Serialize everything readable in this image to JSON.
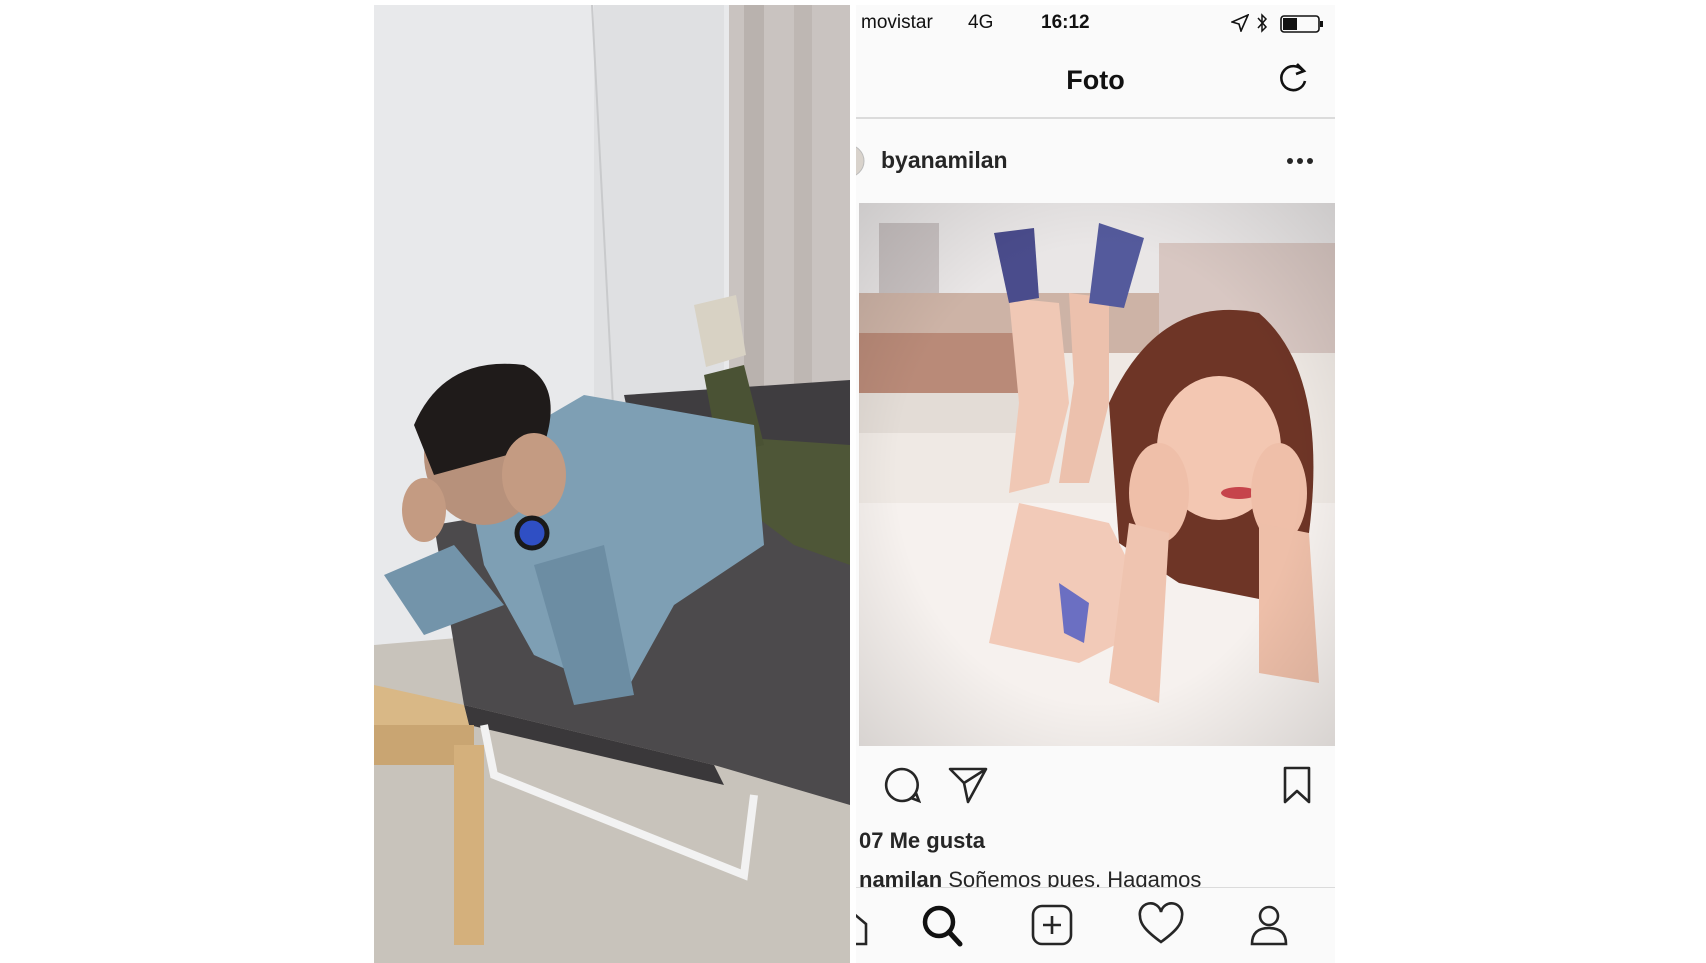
{
  "status_bar": {
    "carrier": "movistar",
    "network": "4G",
    "time": "16:12",
    "location_icon": "location-arrow-icon",
    "bluetooth_icon": "bluetooth-icon",
    "battery_icon": "battery-icon",
    "battery_level": 0.4
  },
  "nav": {
    "title": "Foto",
    "refresh_icon": "refresh-icon"
  },
  "post": {
    "username": "byanamilan",
    "more_icon": "more-dots-icon",
    "actions": [
      "comment-icon",
      "send-icon",
      "bookmark-icon"
    ],
    "likes_text": "07 Me gusta",
    "caption_user": "namilan",
    "caption_text": " Soñemos pues. Hagamos"
  },
  "tab_bar": {
    "items": [
      "home-icon",
      "search-icon",
      "add-post-icon",
      "heart-icon",
      "profile-icon"
    ]
  },
  "colors": {
    "background": "#ffffff",
    "app_background": "#fafafa",
    "text": "#262626",
    "divider": "#dbdbdb"
  }
}
